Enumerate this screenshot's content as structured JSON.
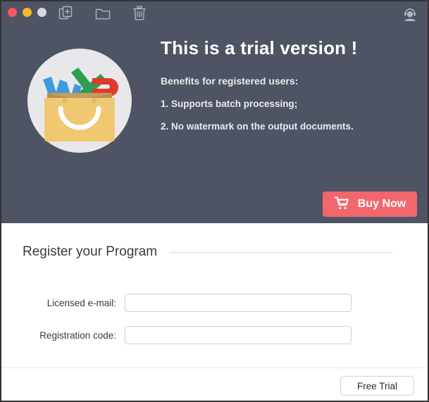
{
  "window": {
    "traffic_lights": [
      {
        "name": "close",
        "color": "#f4595c"
      },
      {
        "name": "minimize",
        "color": "#f7b731"
      },
      {
        "name": "zoom",
        "color": "#d8d8da"
      }
    ],
    "toolbar_icons": [
      {
        "name": "add-document-icon"
      },
      {
        "name": "open-folder-icon"
      },
      {
        "name": "trash-icon"
      }
    ],
    "support_icon": "support-agent-icon"
  },
  "hero": {
    "logo_icon": "shopping-bag-office-docs-icon",
    "title": "This is a trial version !",
    "benefits_heading": "Benefits for registered users:",
    "benefits": [
      "1. Supports batch processing;",
      "2. No watermark on the output documents."
    ]
  },
  "buy": {
    "cart_icon": "shopping-cart-icon",
    "label": "Buy Now",
    "color": "#f2676e"
  },
  "register": {
    "heading": "Register your Program",
    "fields": [
      {
        "label": "Licensed e-mail:",
        "value": "",
        "placeholder": ""
      },
      {
        "label": "Registration code:",
        "value": "",
        "placeholder": ""
      }
    ]
  },
  "footer": {
    "free_trial_label": "Free Trial"
  },
  "colors": {
    "panel_background": "#4e5463",
    "accent": "#f2676e",
    "body_background": "#ffffff",
    "window_border": "#333333"
  }
}
